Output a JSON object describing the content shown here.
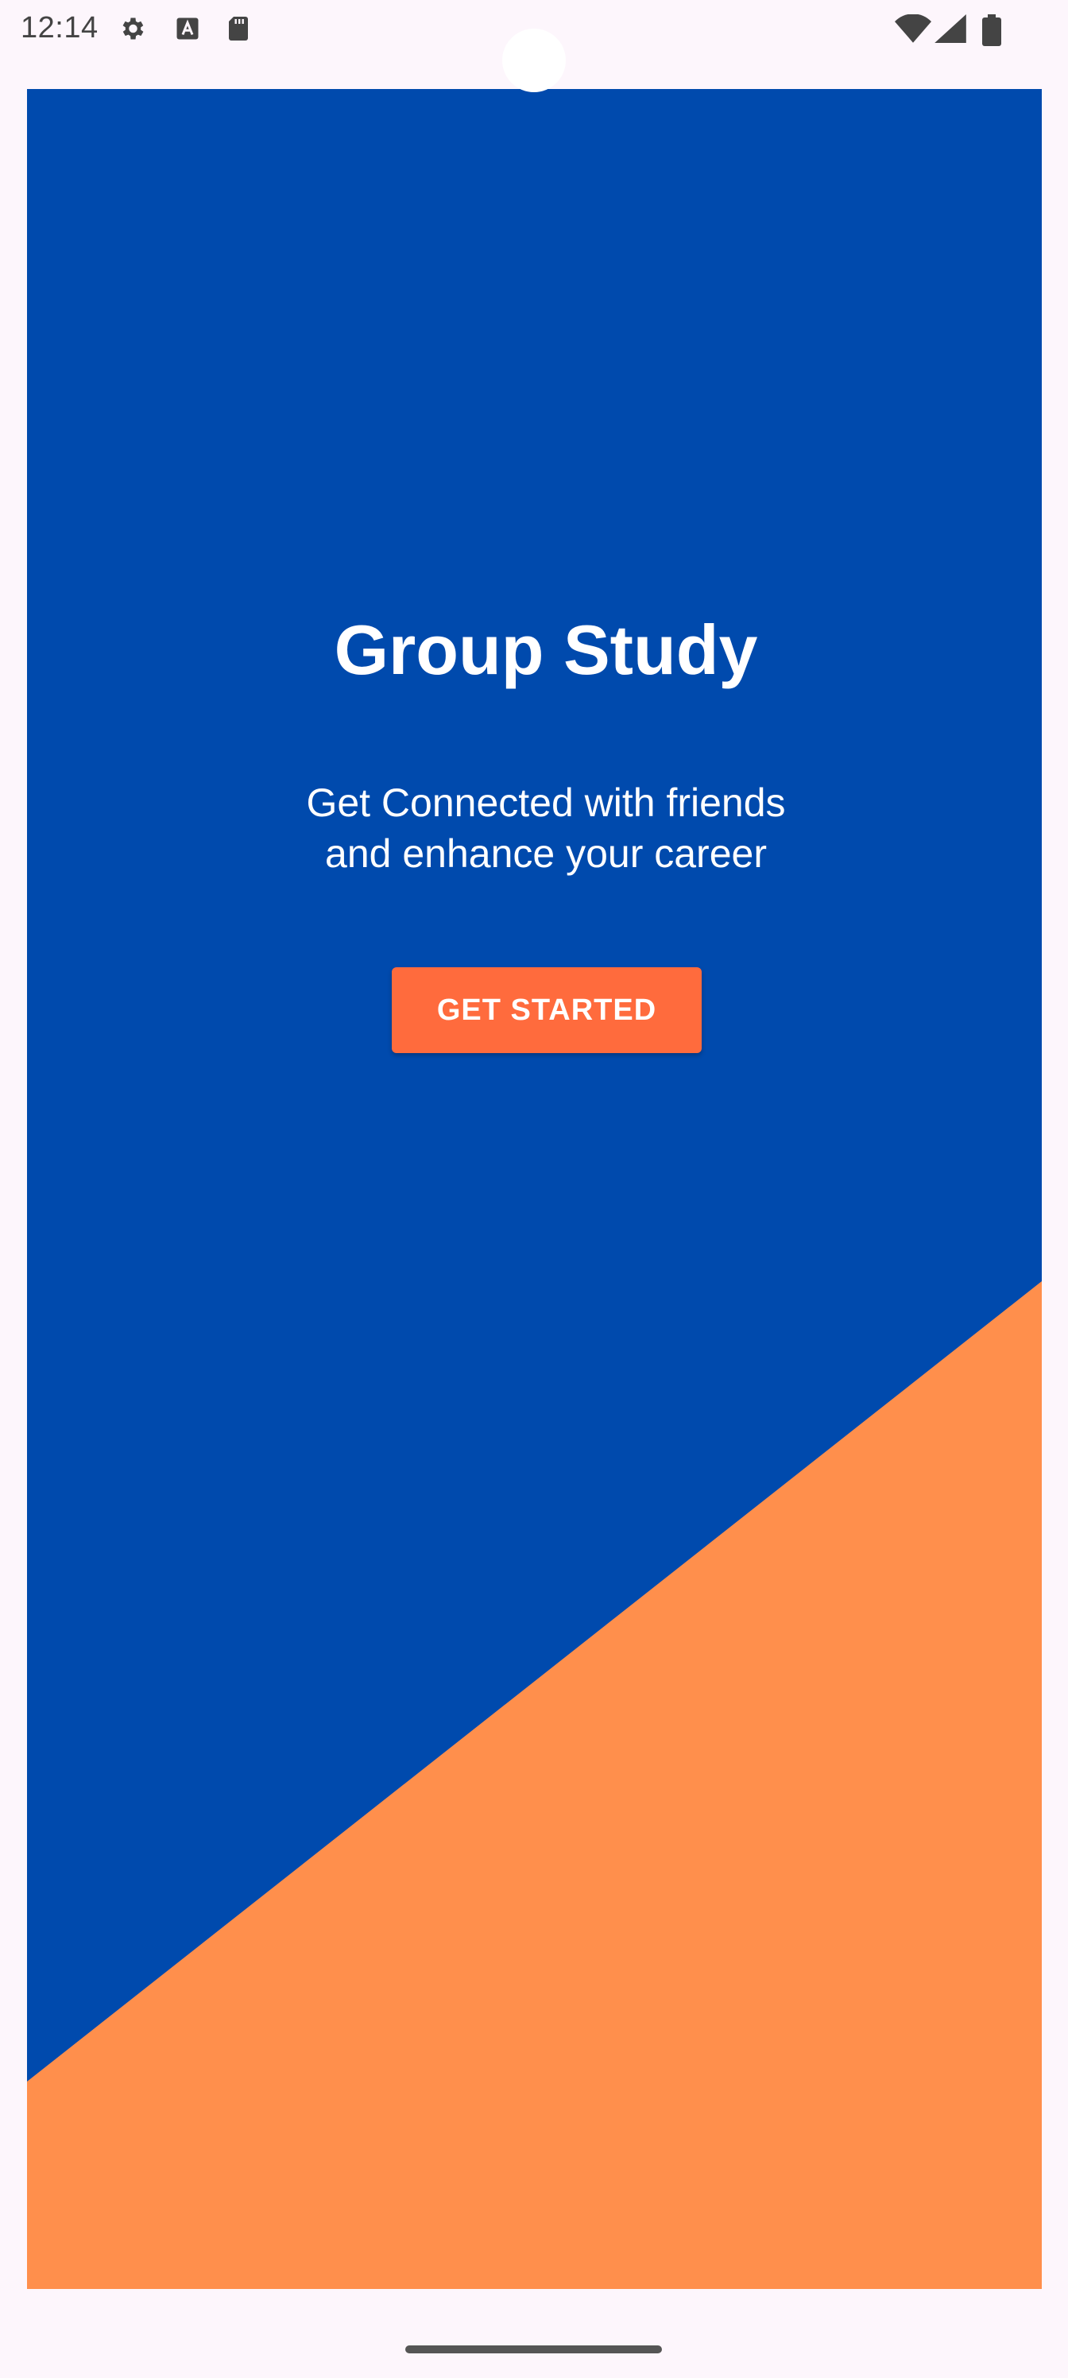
{
  "status_bar": {
    "time": "12:14",
    "left_icons": [
      "gear-icon",
      "text-a-icon",
      "sd-card-icon"
    ],
    "right_icons": [
      "wifi-icon",
      "signal-icon",
      "battery-icon"
    ]
  },
  "screen": {
    "title": "Group Study",
    "subtitle_line1": "Get Connected with friends",
    "subtitle_line2": "and enhance your career",
    "button_label": "GET STARTED"
  },
  "colors": {
    "primary_blue": "#004aad",
    "accent_orange": "#ff8f4c",
    "button_orange": "#ff6b3d",
    "system_background": "#fdf6fc"
  }
}
